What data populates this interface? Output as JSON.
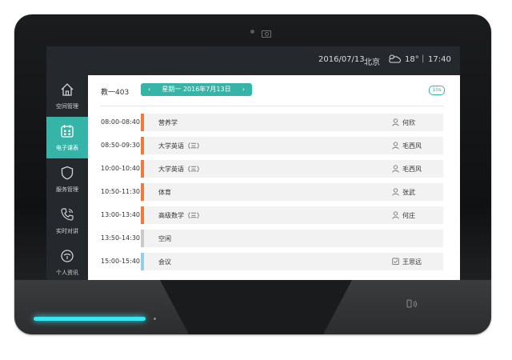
{
  "topbar": {
    "date": "2016/07/13",
    "city": "北京",
    "weather_icon": "partly-cloudy-icon",
    "temperature": "18°",
    "separator": "|",
    "time": "17:40"
  },
  "sidebar": {
    "items": [
      {
        "label": "空间管理",
        "icon": "home-icon",
        "active": false
      },
      {
        "label": "电子课表",
        "icon": "schedule-icon",
        "active": true
      },
      {
        "label": "服务管理",
        "icon": "shield-icon",
        "active": false
      },
      {
        "label": "实时对讲",
        "icon": "phone-icon",
        "active": false
      },
      {
        "label": "个人资讯",
        "icon": "info-icon",
        "active": false
      }
    ]
  },
  "main": {
    "room": "教一403",
    "date_nav": {
      "prev": "‹",
      "label": "星期一  2016年7月13日",
      "next": "›"
    },
    "tag": "10s",
    "schedule": [
      {
        "time": "08:00-08:40",
        "subject": "营养学",
        "person": "何欣",
        "person_icon": "user-icon",
        "status_color": "#f07a3c"
      },
      {
        "time": "08:50-09:30",
        "subject": "大学英语（三）",
        "person": "毛西风",
        "person_icon": "user-icon",
        "status_color": "#f07a3c"
      },
      {
        "time": "10:00-10:40",
        "subject": "大学英语（三）",
        "person": "毛西风",
        "person_icon": "user-icon",
        "status_color": "#f07a3c"
      },
      {
        "time": "10:50-11:30",
        "subject": "体育",
        "person": "张武",
        "person_icon": "user-icon",
        "status_color": "#f07a3c"
      },
      {
        "time": "13:00-13:40",
        "subject": "高级数学（三）",
        "person": "何庄",
        "person_icon": "user-icon",
        "status_color": "#f07a3c"
      },
      {
        "time": "13:50-14:30",
        "subject": "空闲",
        "person": "",
        "person_icon": "",
        "status_color": "#c9c9c9"
      },
      {
        "time": "15:00-15:40",
        "subject": "会议",
        "person": "王思远",
        "person_icon": "check-icon",
        "status_color": "#8fd0e8"
      }
    ]
  },
  "colors": {
    "accent": "#36b4a8",
    "led": "#36e7f2",
    "sidebar_bg": "#25292d"
  }
}
